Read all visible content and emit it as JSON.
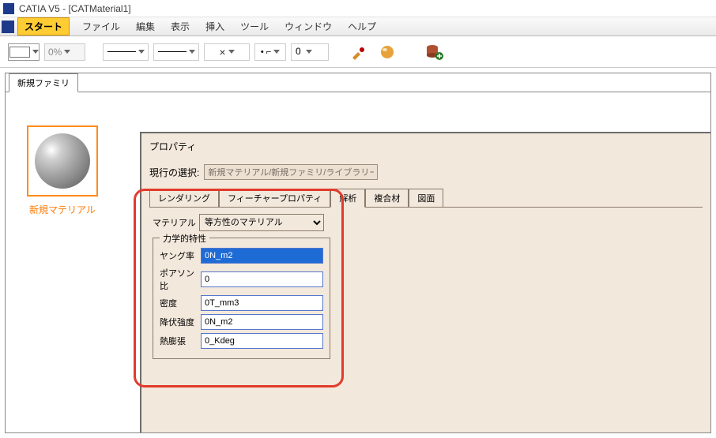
{
  "window": {
    "title": "CATIA V5 - [CATMaterial1]"
  },
  "menu": {
    "start": "スタート",
    "items": [
      "ファイル",
      "編集",
      "表示",
      "挿入",
      "ツール",
      "ウィンドウ",
      "ヘルプ"
    ]
  },
  "toolbar": {
    "percent": "0%",
    "x": "×",
    "pointSym": "• ⌐",
    "layer": "0"
  },
  "outerTab": {
    "label": "新規ファミリ"
  },
  "material": {
    "thumb_label": "新規マテリアル"
  },
  "prop": {
    "title": "プロパティ",
    "currentSel_label": "現行の選択:",
    "currentSel_value": "新規マテリアル/新規ファミリ/ライブラリー",
    "tabs": {
      "rendering": "レンダリング",
      "feature": "フィーチャープロパティ",
      "analysis": "解析",
      "composite": "複合材",
      "drawing": "図面"
    },
    "matType_label": "マテリアル",
    "matType_value": "等方性のマテリアル",
    "fieldset_legend": "力学的特性",
    "fields": {
      "young_label": "ヤング率",
      "young_value": "0N_m2",
      "poisson_label": "ポアソン比",
      "poisson_value": "0",
      "density_label": "密度",
      "density_value": "0T_mm3",
      "yield_label": "降伏強度",
      "yield_value": "0N_m2",
      "thermal_label": "熱膨張",
      "thermal_value": "0_Kdeg"
    }
  }
}
